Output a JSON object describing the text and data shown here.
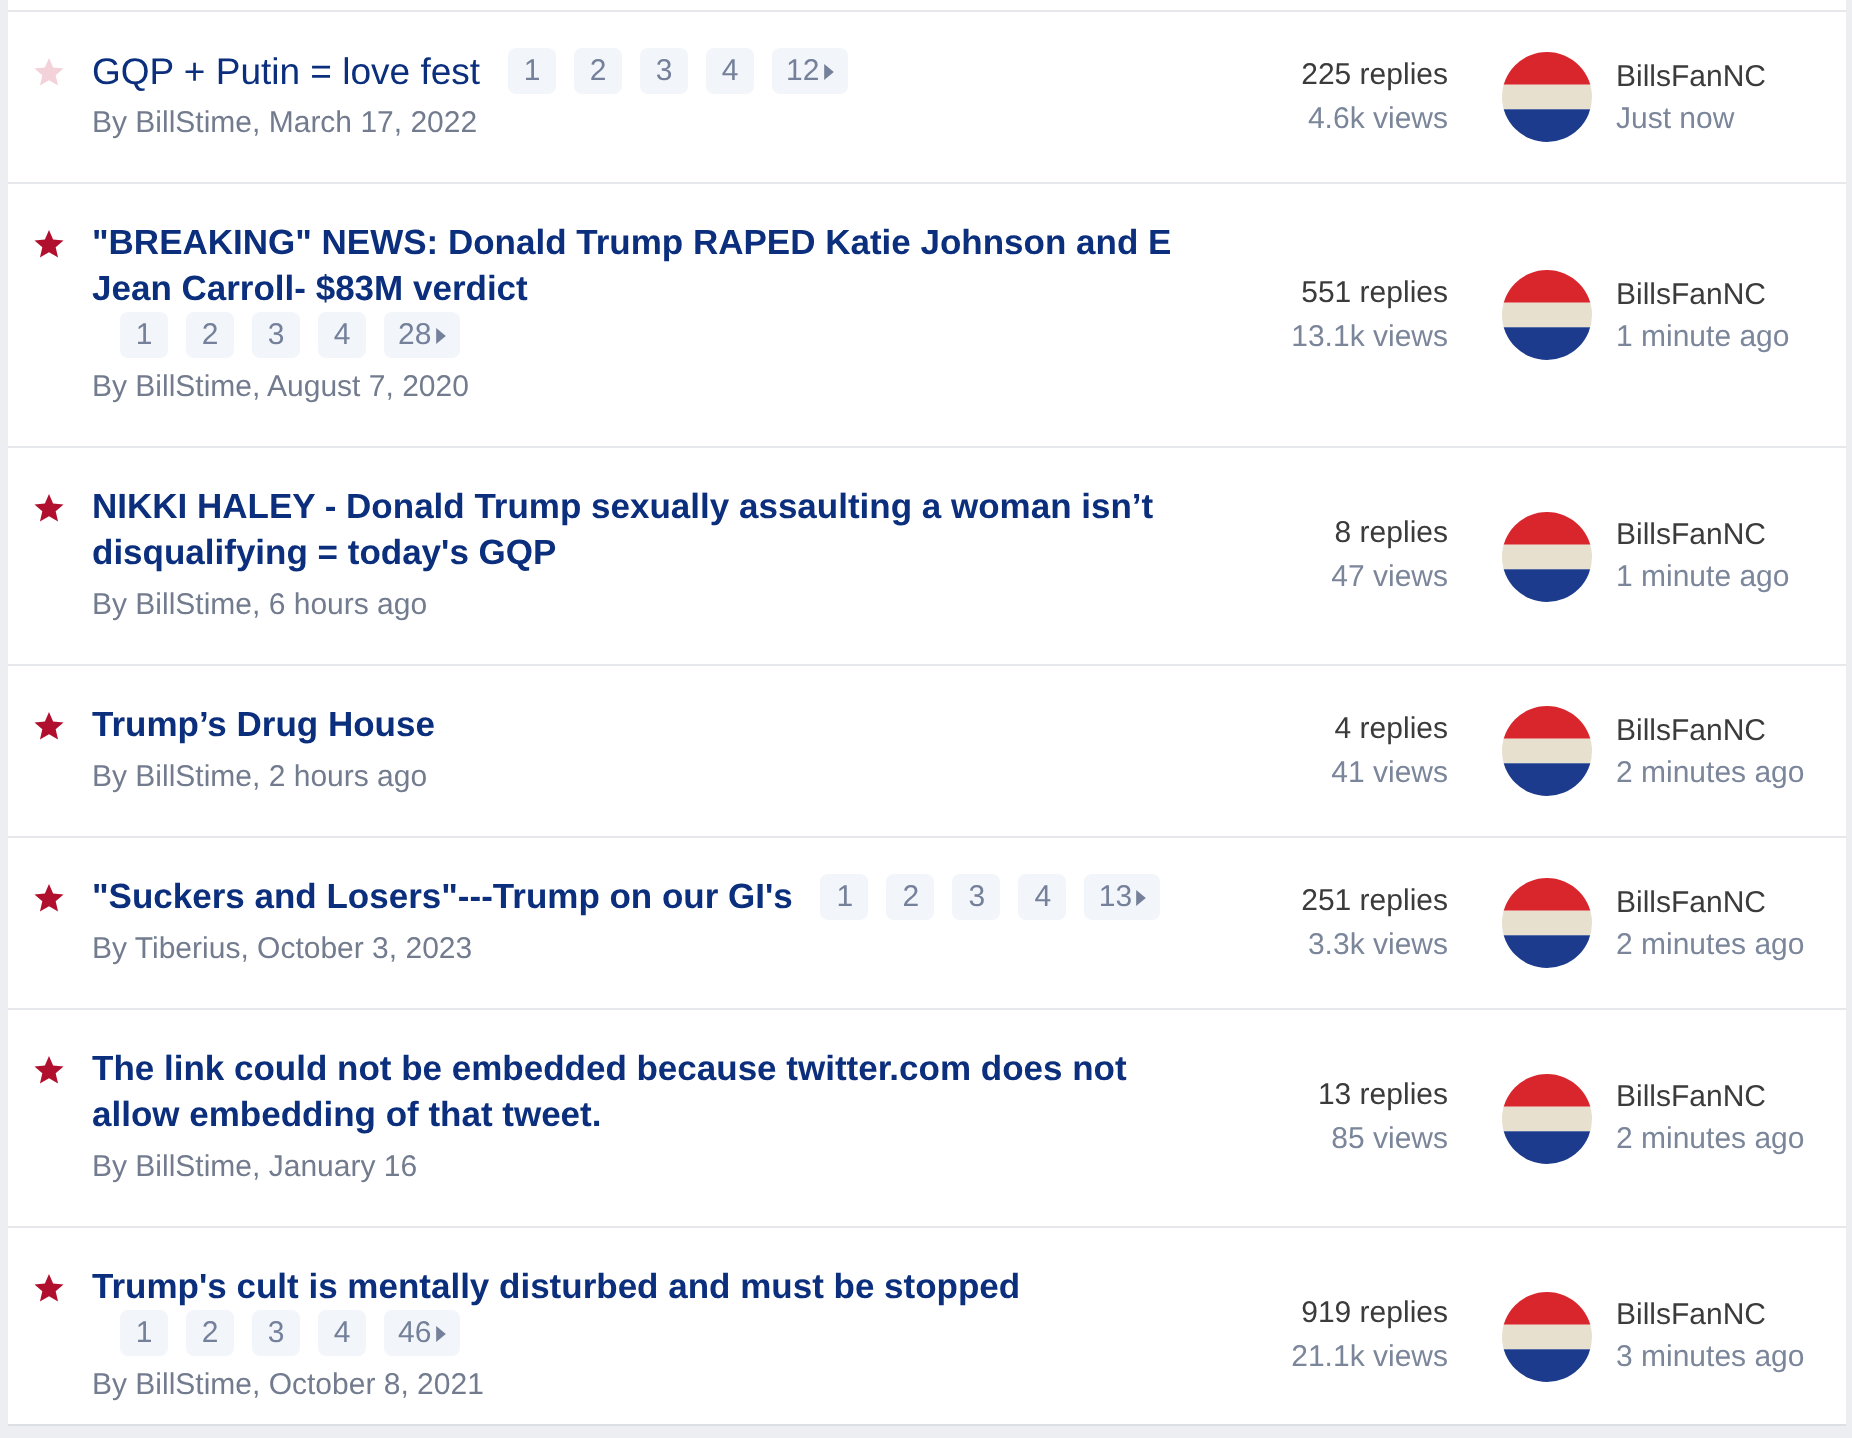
{
  "topics": [
    {
      "title": "GQP + Putin = love fest",
      "unread": false,
      "pages": [
        "1",
        "2",
        "3",
        "4",
        "12"
      ],
      "byline": "By BillStime, March 17, 2022",
      "replies": "225 replies",
      "views": "4.6k views",
      "last_poster": "BillsFanNC",
      "last_time": "Just now"
    },
    {
      "title": "\"BREAKING\" NEWS: Donald Trump RAPED Katie Johnson and E Jean Carroll- $83M verdict",
      "unread": true,
      "pages": [
        "1",
        "2",
        "3",
        "4",
        "28"
      ],
      "byline": "By BillStime, August 7, 2020",
      "replies": "551 replies",
      "views": "13.1k views",
      "last_poster": "BillsFanNC",
      "last_time": "1 minute ago"
    },
    {
      "title": "NIKKI HALEY - Donald Trump sexually assaulting a woman isn’t disqualifying = today's GQP",
      "unread": true,
      "byline": "By BillStime, 6 hours ago",
      "replies": "8 replies",
      "views": "47 views",
      "last_poster": "BillsFanNC",
      "last_time": "1 minute ago"
    },
    {
      "title": "Trump’s Drug House",
      "unread": true,
      "byline": "By BillStime, 2 hours ago",
      "replies": "4 replies",
      "views": "41 views",
      "last_poster": "BillsFanNC",
      "last_time": "2 minutes ago"
    },
    {
      "title": "\"Suckers and Losers\"---Trump on our GI's",
      "unread": true,
      "pages": [
        "1",
        "2",
        "3",
        "4",
        "13"
      ],
      "byline": "By Tiberius, October 3, 2023",
      "replies": "251 replies",
      "views": "3.3k views",
      "last_poster": "BillsFanNC",
      "last_time": "2 minutes ago"
    },
    {
      "title": "The link could not be embedded because twitter.com does not allow embedding of that tweet.",
      "unread": true,
      "byline": "By BillStime, January 16",
      "replies": "13 replies",
      "views": "85 views",
      "last_poster": "BillsFanNC",
      "last_time": "2 minutes ago"
    },
    {
      "title": "Trump's cult is mentally disturbed and must be stopped",
      "unread": true,
      "pages": [
        "1",
        "2",
        "3",
        "4",
        "46"
      ],
      "byline": "By BillStime, October 8, 2021",
      "replies": "919 replies",
      "views": "21.1k views",
      "last_poster": "BillsFanNC",
      "last_time": "3 minutes ago"
    }
  ]
}
